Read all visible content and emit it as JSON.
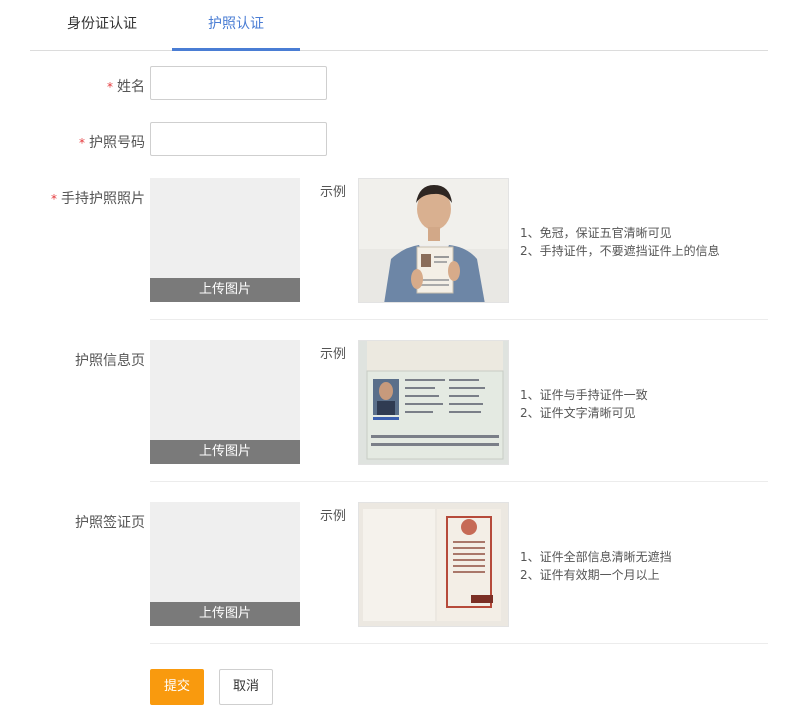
{
  "tabs": [
    "身份证认证",
    "护照认证"
  ],
  "form": {
    "required_mark": "*",
    "name_label": "姓名",
    "passport_no_label": "护照号码",
    "name_value": "",
    "passport_no_value": ""
  },
  "sections": [
    {
      "label": "手持护照照片",
      "required": true,
      "upload_label": "上传图片",
      "sample_label": "示例",
      "tips": [
        "1、免冠，保证五官清晰可见",
        "2、手持证件，不要遮挡证件上的信息"
      ]
    },
    {
      "label": "护照信息页",
      "required": false,
      "upload_label": "上传图片",
      "sample_label": "示例",
      "tips": [
        "1、证件与手持证件一致",
        "2、证件文字清晰可见"
      ]
    },
    {
      "label": "护照签证页",
      "required": false,
      "upload_label": "上传图片",
      "sample_label": "示例",
      "tips": [
        "1、证件全部信息清晰无遮挡",
        "2、证件有效期一个月以上"
      ]
    }
  ],
  "buttons": {
    "submit": "提交",
    "cancel": "取消"
  },
  "colors": {
    "accent": "#4a7dd4",
    "submit": "#f99a0e",
    "required": "#e4393c"
  }
}
